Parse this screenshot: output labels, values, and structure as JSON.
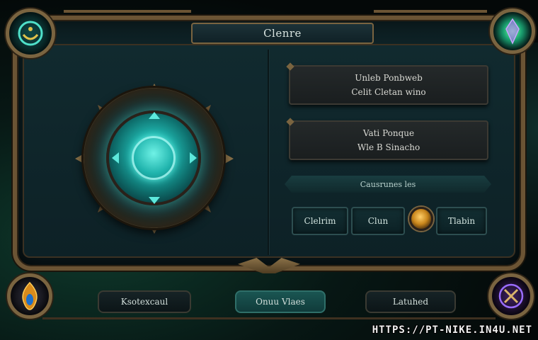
{
  "header": {
    "title": "Clenre"
  },
  "info_boxes": [
    {
      "line1": "Unleb Ponbweb",
      "line2": "Celit Cletan wino"
    },
    {
      "line1": "Vati Ponque",
      "line2": "Wle B Sinacho"
    }
  ],
  "category_bar": {
    "label": "Causrunes les"
  },
  "tabs": [
    {
      "label": "Clelrim"
    },
    {
      "label": "Clun"
    },
    {
      "label": "Tlabin"
    }
  ],
  "bottom_buttons": [
    {
      "label": "Ksotexcaul",
      "active": false
    },
    {
      "label": "Onuu Vlaes",
      "active": true
    },
    {
      "label": "Latuhed",
      "active": false
    }
  ],
  "watermark": "HTTPS://PT-NIKE.IN4U.NET",
  "colors": {
    "gold_frame": "#7a6440",
    "teal_glow": "#1fb3ac",
    "panel_bg": "#112a2f",
    "active_button": "#1a5552",
    "orb_amber": "#c9861c"
  },
  "icons": {
    "top_left_orb": "emblem-orb-icon",
    "top_right_orb": "crystal-orb-icon",
    "bottom_left_orb": "flame-eye-orb-icon",
    "bottom_right_orb": "rune-orb-icon"
  }
}
